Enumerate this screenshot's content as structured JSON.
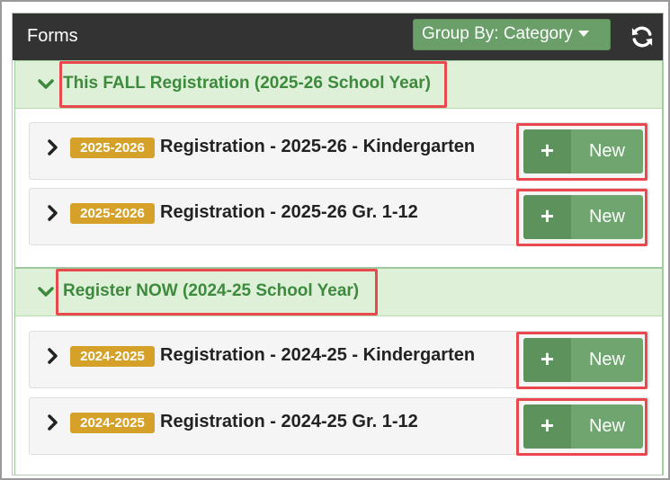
{
  "header": {
    "title": "Forms",
    "group_by_label": "Group By: Category"
  },
  "categories": [
    {
      "title": "This FALL Registration (2025-26 School Year)",
      "forms": [
        {
          "badge": "2025-2026",
          "name": "Registration - 2025-26 - Kindergarten",
          "new_label": "New",
          "plus": "+"
        },
        {
          "badge": "2025-2026",
          "name": "Registration - 2025-26 Gr. 1-12",
          "new_label": "New",
          "plus": "+"
        }
      ]
    },
    {
      "title": "Register NOW (2024-25 School Year)",
      "forms": [
        {
          "badge": "2024-2025",
          "name": "Registration - 2024-25 - Kindergarten",
          "new_label": "New",
          "plus": "+"
        },
        {
          "badge": "2024-2025",
          "name": "Registration - 2024-25 Gr. 1-12",
          "new_label": "New",
          "plus": "+"
        }
      ]
    }
  ],
  "colors": {
    "header_bg": "#333333",
    "group_by_bg": "#6a9f6a",
    "category_bg": "#dff0d8",
    "category_text": "#3c8a3c",
    "badge_bg": "#d6a128",
    "highlight": "#e8484e"
  },
  "icons": {
    "refresh": "refresh-icon",
    "category_toggle": "chevron-down-icon",
    "row_toggle": "chevron-right-icon"
  }
}
